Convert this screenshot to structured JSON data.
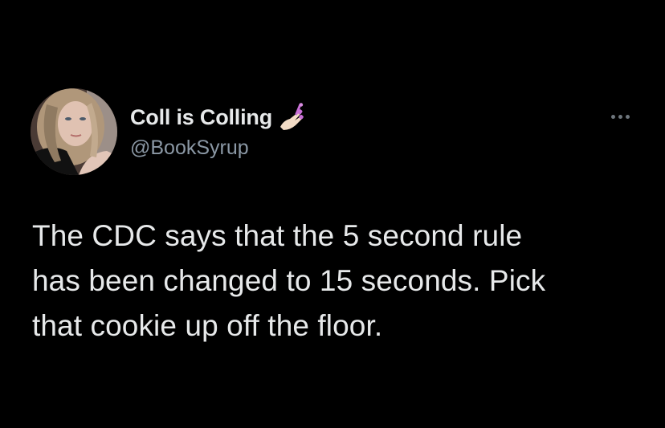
{
  "tweet": {
    "author": {
      "display_name": "Coll is Colling",
      "handle": "@BookSyrup",
      "name_emoji": "nail-polish-emoji",
      "avatar": "profile-photo"
    },
    "more_icon": "more-options-icon",
    "text_lines": [
      "The CDC says that the 5 second rule",
      "has been changed to 15 seconds. Pick",
      "that cookie up off the floor."
    ]
  },
  "colors": {
    "background": "#000000",
    "primary_text": "#e7e9ea",
    "secondary_text": "#8b98a5",
    "icon": "#6e767d",
    "emoji_nail": "#c86fd6"
  }
}
